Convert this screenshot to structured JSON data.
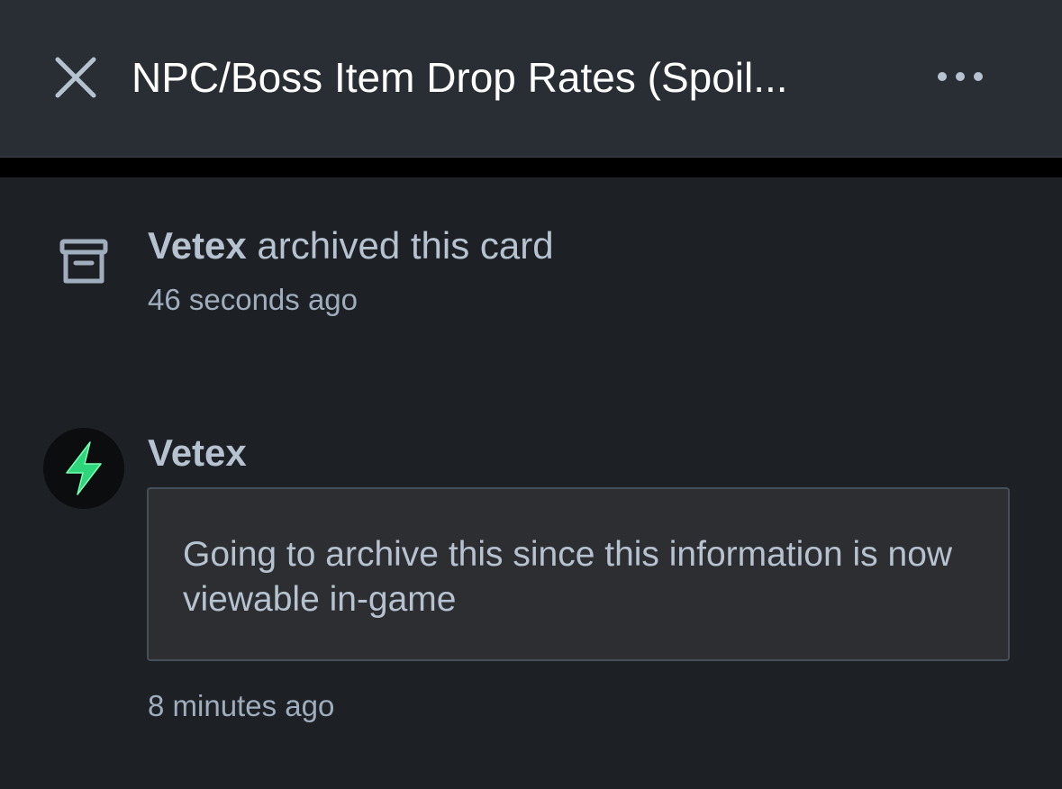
{
  "header": {
    "title": "NPC/Boss Item Drop Rates (Spoil...",
    "close_icon": "close-icon",
    "more_icon": "more-horizontal-icon"
  },
  "activity": {
    "icon": "archive-icon",
    "actor": "Vetex",
    "action": " archived this card",
    "timestamp": "46 seconds ago"
  },
  "comment": {
    "avatar_icon": "lightning-bolt-icon",
    "author": "Vetex",
    "text": "Going to archive this since this information is now viewable in-game",
    "timestamp": "8 minutes ago"
  },
  "colors": {
    "background": "#1d2125",
    "header_background": "#282e33",
    "primary_text": "#b6c2cf",
    "secondary_text": "#9fadbc",
    "comment_background": "#2c2e31",
    "avatar_bolt": "#2dd67a"
  }
}
